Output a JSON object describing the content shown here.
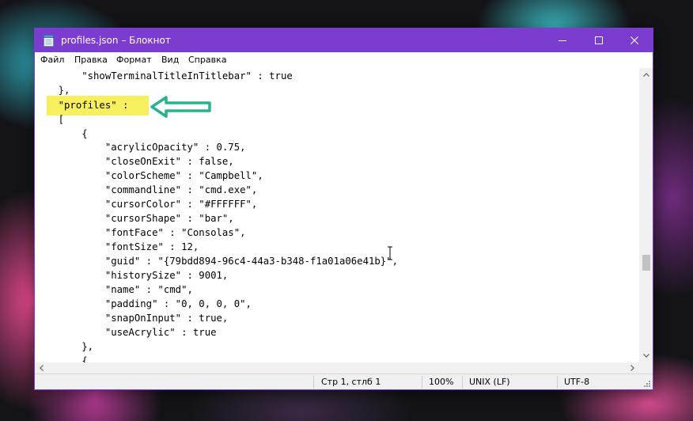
{
  "window": {
    "title": "profiles.json – Блокнот"
  },
  "menu": {
    "file": "Файл",
    "edit": "Правка",
    "format": "Формат",
    "view": "Вид",
    "help": "Справка"
  },
  "editor": {
    "lines": [
      "        \"showTerminalTitleInTitlebar\" : true",
      "    },",
      "    \"profiles\" :",
      "    [",
      "        {",
      "            \"acrylicOpacity\" : 0.75,",
      "            \"closeOnExit\" : false,",
      "            \"colorScheme\" : \"Campbell\",",
      "            \"commandline\" : \"cmd.exe\",",
      "            \"cursorColor\" : \"#FFFFFF\",",
      "            \"cursorShape\" : \"bar\",",
      "            \"fontFace\" : \"Consolas\",",
      "            \"fontSize\" : 12,",
      "            \"guid\" : \"{79bdd894-96c4-44a3-b348-f1a01a06e41b}\",",
      "            \"historySize\" : 9001,",
      "            \"name\" : \"cmd\",",
      "            \"padding\" : \"0, 0, 0, 0\",",
      "            \"snapOnInput\" : true,",
      "            \"useAcrylic\" : true",
      "        },",
      "        {"
    ]
  },
  "statusbar": {
    "position": "Стр 1, стлб 1",
    "zoom": "100%",
    "line_ending": "UNIX (LF)",
    "encoding": "UTF-8"
  },
  "colors": {
    "titlebar": "#7c3cd0",
    "highlight": "#f6ef5e",
    "arrow": "#27b38d"
  },
  "icons": [
    "notepad-icon",
    "minimize-icon",
    "maximize-icon",
    "close-icon",
    "arrow-left-icon"
  ]
}
